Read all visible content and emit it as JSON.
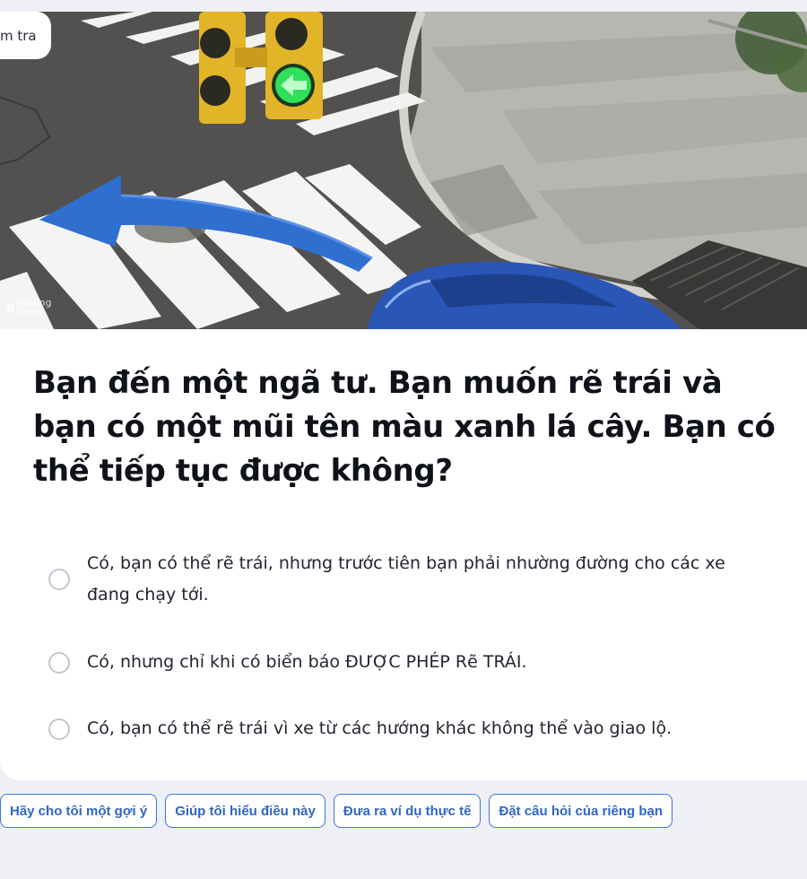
{
  "badge": {
    "label": "m tra"
  },
  "watermark": {
    "mark": "ฮ",
    "line1": "driving",
    "line2": "tests"
  },
  "question": {
    "text": "Bạn đến một ngã tư. Bạn muốn rẽ trái và bạn có một mũi tên màu xanh lá cây. Bạn có thể tiếp tục được không?"
  },
  "options": [
    {
      "text": "Có, bạn có thể rẽ trái, nhưng trước tiên bạn phải nhường đường cho các xe đang chạy tới."
    },
    {
      "text": "Có, nhưng chỉ khi có biển báo ĐƯỢC PHÉP Rẽ TRÁI."
    },
    {
      "text": "Có, bạn có thể rẽ trái vì xe từ các hướng khác không thể vào giao lộ."
    }
  ],
  "help_chips": [
    {
      "label": "Hãy cho tôi một gợi ý"
    },
    {
      "label": "Giúp tôi hiểu điều này"
    },
    {
      "label": "Đưa ra ví dụ thực tế"
    },
    {
      "label": "Đặt câu hỏi của riêng bạn"
    }
  ],
  "colors": {
    "accent": "#3f76d8",
    "arrow": "#2f6fd0",
    "signal_green": "#2ee05a",
    "signal_housing": "#e2b528",
    "car": "#2a56b8"
  },
  "icons": {
    "traffic_light": "traffic-light-icon",
    "turn_arrow": "left-turn-arrow-icon",
    "radio": "radio-circle-icon"
  }
}
